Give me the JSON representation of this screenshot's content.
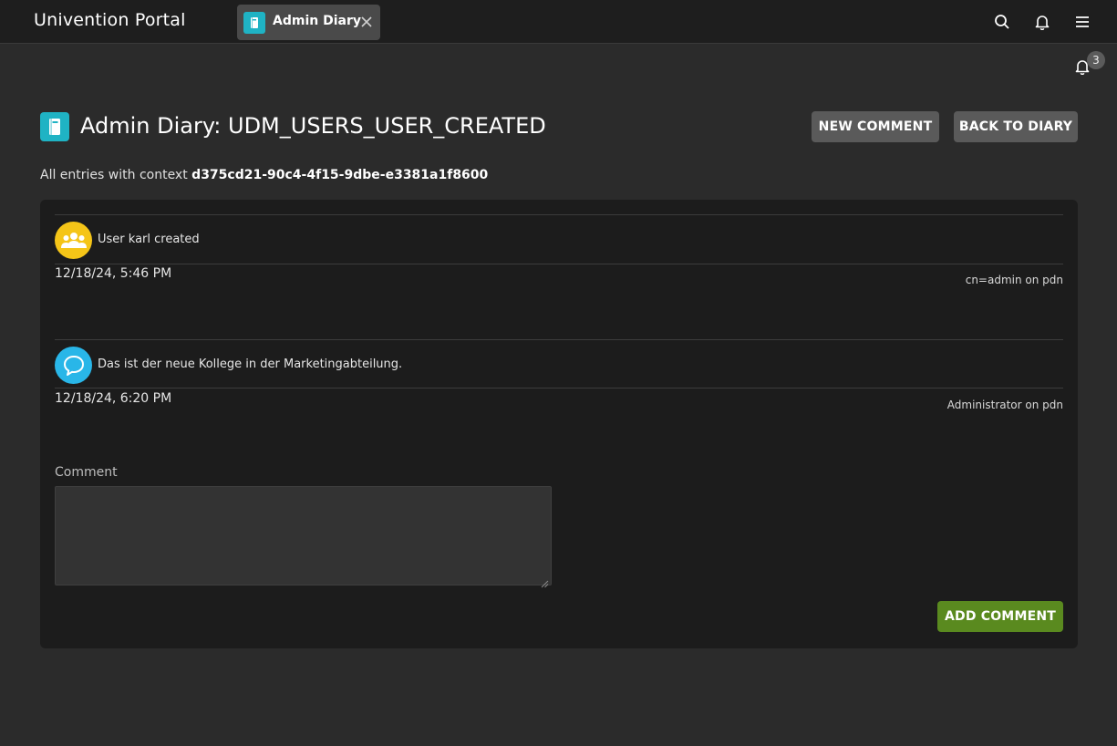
{
  "header": {
    "portal_title": "Univention Portal",
    "tab_label": "Admin Diary"
  },
  "notifications": {
    "count": "3"
  },
  "page": {
    "title": "Admin Diary: UDM_USERS_USER_CREATED",
    "new_comment_label": "NEW COMMENT",
    "back_label": "BACK TO DIARY",
    "context_prefix": "All entries with context",
    "context_id": "d375cd21-90c4-4f15-9dbe-e3381a1f8600"
  },
  "entries": [
    {
      "icon": "users-icon",
      "message": "User karl created",
      "date": "12/18/24, 5:46 PM",
      "author": "cn=admin on pdn"
    },
    {
      "icon": "comment-icon",
      "message": "Das ist der neue Kollege in der Marketingabteilung.",
      "date": "12/18/24, 6:20 PM",
      "author": "Administrator on pdn"
    }
  ],
  "comment_form": {
    "label": "Comment",
    "value": "",
    "submit_label": "ADD COMMENT"
  },
  "colors": {
    "accent_teal": "#1fb3c4",
    "user_event_yellow": "#f5c518",
    "comment_blue": "#29b6e8",
    "submit_green": "#5a8a1f"
  }
}
